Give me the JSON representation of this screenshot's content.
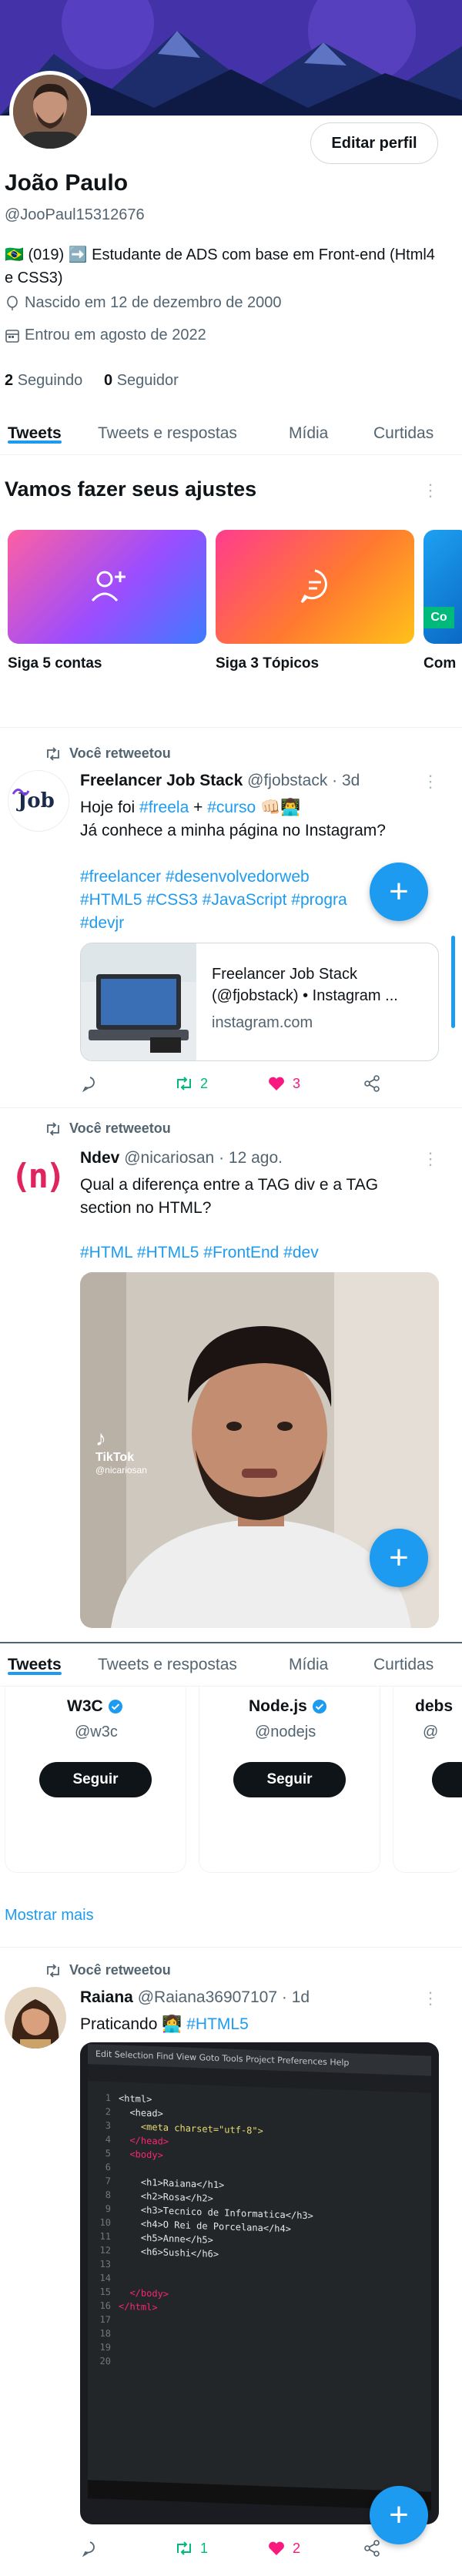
{
  "profile": {
    "name": "João Paulo",
    "handle": "@JooPaul15312676",
    "edit_label": "Editar perfil",
    "bio": "🇧🇷 (019) ➡️ Estudante de ADS com base em Front-end (Html4 e CSS3)",
    "birth": "Nascido em 12 de dezembro de 2000",
    "joined": "Entrou em agosto de 2022",
    "following_count": "2",
    "following_label": "Seguindo",
    "followers_count": "0",
    "followers_label": "Seguidor"
  },
  "tabs": [
    "Tweets",
    "Tweets e respostas",
    "Mídia",
    "Curtidas"
  ],
  "setup": {
    "title": "Vamos fazer seus ajustes",
    "cards": [
      {
        "label": "Siga 5 contas",
        "icon": "add-person-icon"
      },
      {
        "label": "Siga 3 Tópicos",
        "icon": "topic-icon"
      },
      {
        "label": "Com"
      }
    ],
    "badge": "Co"
  },
  "tweets": [
    {
      "retweet_label": "Você retweetou",
      "author": "Freelancer Job Stack",
      "handle": "@fjobstack",
      "time": "· 3d",
      "avatar_text": "Job",
      "text_line1_plain": "Hoje foi ",
      "text_line1_tag1": "#freela",
      "text_line1_mid": " + ",
      "text_line1_tag2": "#curso",
      "text_line1_emoji": " 👊🏻👨‍💻",
      "text_line2": "Já conhece a minha página no Instagram?",
      "tags_line1": "#freelancer #desenvolvedorweb",
      "tags_line2": "#HTML5 #CSS3 #JavaScript #progra",
      "tags_line3": "#devjr",
      "link_title": "Freelancer Job Stack (@fjobstack) • Instagram ...",
      "link_domain": "instagram.com",
      "retweets": "2",
      "likes": "3"
    },
    {
      "retweet_label": "Você retweetou",
      "author": "Ndev",
      "handle": "@nicariosan",
      "time": "· 12 ago.",
      "avatar_text": "(n)",
      "text": "Qual a diferença entre a TAG div e a TAG section no HTML?",
      "tags": "#HTML #HTML5 #FrontEnd #dev",
      "tiktok_label": "TikTok",
      "tiktok_handle": "@nicariosan"
    },
    {
      "retweet_label": "Você retweetou",
      "author": "Raiana",
      "handle": "@Raiana36907107",
      "time": "· 1d",
      "text_plain": "Praticando 👩‍💻 ",
      "text_tag": "#HTML5",
      "retweets": "1",
      "likes": "2"
    }
  ],
  "who_to_follow": {
    "cards": [
      {
        "name": "W3C",
        "handle": "@w3c",
        "button": "Seguir"
      },
      {
        "name": "Node.js",
        "handle": "@nodejs",
        "button": "Seguir"
      },
      {
        "name": "debs",
        "handle": "@"
      }
    ],
    "show_more": "Mostrar mais"
  },
  "code_editor": {
    "menu": "Edit  Selection  Find  View  Goto  Tools  Project  Preferences  Help",
    "lines": [
      "<html>",
      "  <head>",
      "    <meta charset=\"utf-8\">",
      "  </head>",
      "  <body>",
      "",
      "    <h1>Raiana</h1>",
      "    <h2>Rosa</h2>",
      "    <h3>Tecnico de Informatica</h3>",
      "    <h4>O Rei de Porcelana</h4>",
      "    <h5>Anne</h5>",
      "    <h6>Sushi</h6>",
      "",
      "",
      "  </body>",
      "</html>"
    ]
  },
  "colors": {
    "accent": "#1d9bf0",
    "like": "#f91880",
    "retweet": "#00ba7c"
  }
}
